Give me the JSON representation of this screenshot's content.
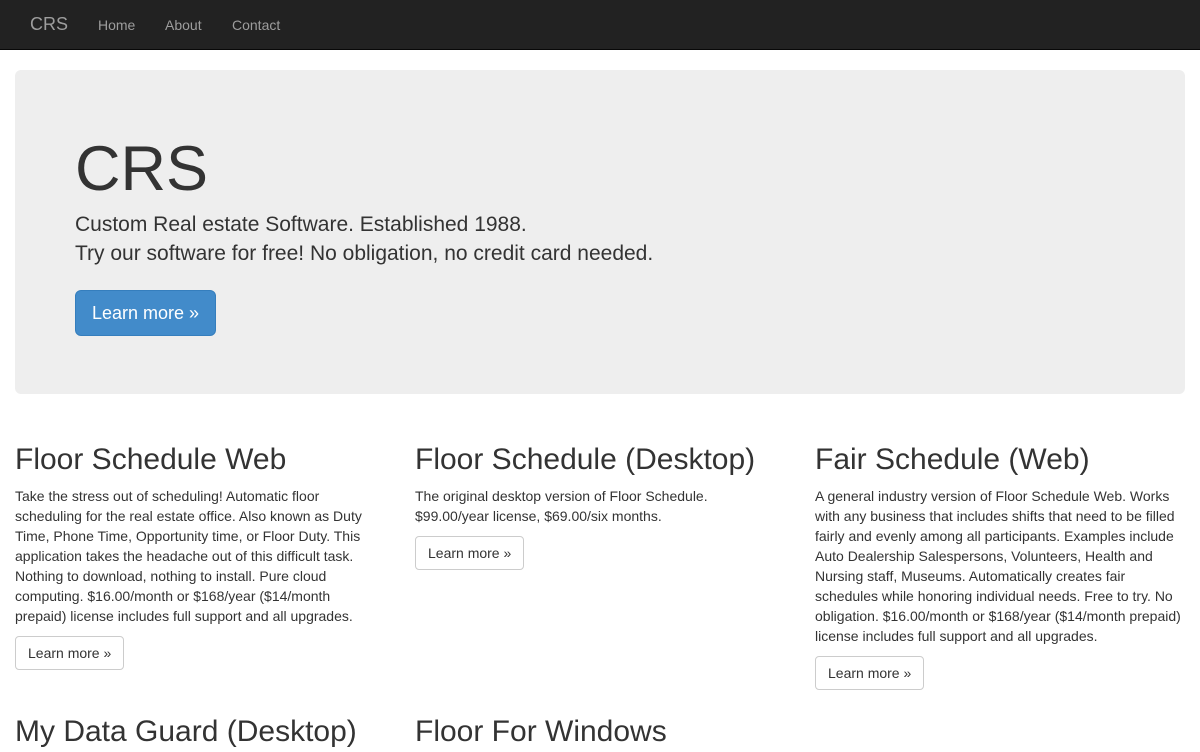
{
  "navbar": {
    "brand": "CRS",
    "links": [
      "Home",
      "About",
      "Contact"
    ]
  },
  "jumbotron": {
    "title": "CRS",
    "lead_1": "Custom Real estate Software. Established 1988.",
    "lead_2": "Try our software for free! No obligation, no credit card needed.",
    "button": "Learn more »"
  },
  "products": [
    {
      "title": "Floor Schedule Web",
      "description": "Take the stress out of scheduling! Automatic floor scheduling for the real estate office. Also known as Duty Time, Phone Time, Opportunity time, or Floor Duty. This application takes the headache out of this difficult task. Nothing to download, nothing to install. Pure cloud computing. $16.00/month or $168/year ($14/month prepaid) license includes full support and all upgrades.",
      "button": "Learn more »"
    },
    {
      "title": "Floor Schedule (Desktop)",
      "description": "The original desktop version of Floor Schedule. $99.00/year license, $69.00/six months.",
      "button": "Learn more »"
    },
    {
      "title": "Fair Schedule (Web)",
      "description": "A general industry version of Floor Schedule Web. Works with any business that includes shifts that need to be filled fairly and evenly among all participants. Examples include Auto Dealership Salespersons, Volunteers, Health and Nursing staff, Museums. Automatically creates fair schedules while honoring individual needs. Free to try. No obligation. $16.00/month or $168/year ($14/month prepaid) license includes full support and all upgrades.",
      "button": "Learn more »"
    }
  ],
  "products_row2": [
    {
      "title": "My Data Guard (Desktop)"
    },
    {
      "title": "Floor For Windows"
    }
  ],
  "colors": {
    "navbar_bg": "#222222",
    "nav_text": "#9d9d9d",
    "jumbotron_bg": "#eeeeee",
    "primary": "#428bca"
  }
}
